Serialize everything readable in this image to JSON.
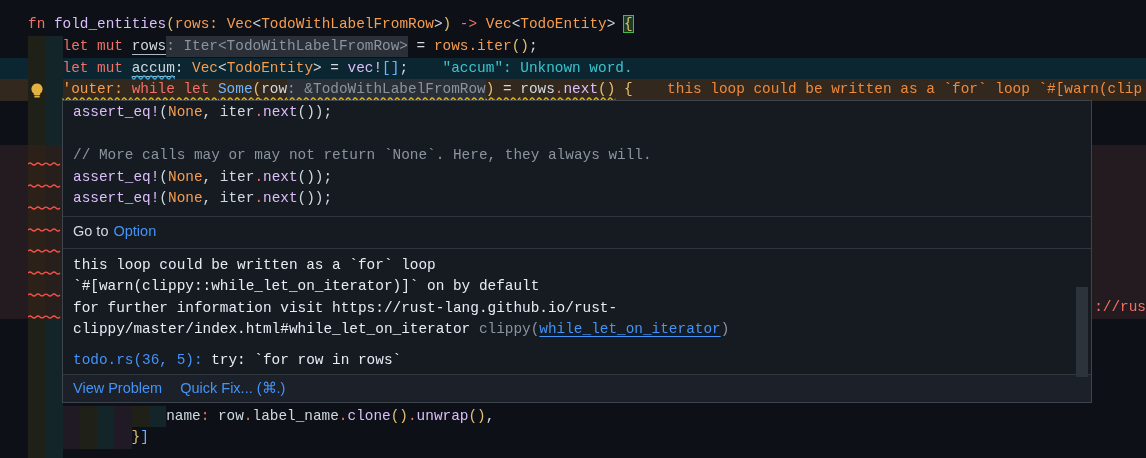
{
  "editor": {
    "lines": [
      {
        "kind": "code",
        "lightbulb": false,
        "tokens": [
          {
            "text": "fn ",
            "kind": "keyword"
          },
          {
            "text": "fold_entities",
            "kind": "function"
          },
          {
            "text": "(",
            "kind": "brace"
          },
          {
            "text": "rows: Vec",
            "kind": "type"
          },
          {
            "text": "<",
            "kind": "plain"
          },
          {
            "text": "TodoWithLabelFromRow",
            "kind": "type"
          },
          {
            "text": ">",
            "kind": "plain"
          },
          {
            "text": ")",
            "kind": "brace"
          },
          {
            "text": " -> ",
            "kind": "keyword"
          },
          {
            "text": "Vec",
            "kind": "type"
          },
          {
            "text": "<",
            "kind": "plain"
          },
          {
            "text": "TodoEntity",
            "kind": "type"
          },
          {
            "text": "> ",
            "kind": "plain"
          },
          {
            "text": "{",
            "kind": "brace",
            "matched": true
          }
        ]
      },
      {
        "kind": "code",
        "lightbulb": false,
        "tokens": [
          {
            "text": "    let mut ",
            "kind": "keyword"
          },
          {
            "text": "rows",
            "kind": "plain",
            "underline": true
          },
          {
            "text": ": Iter<TodoWithLabelFromRow>",
            "kind": "hint"
          },
          {
            "text": " = ",
            "kind": "plain"
          },
          {
            "text": "rows.iter",
            "kind": "type"
          },
          {
            "text": "()",
            "kind": "brace"
          },
          {
            "text": ";",
            "kind": "plain"
          }
        ]
      },
      {
        "kind": "info",
        "lightbulb": false,
        "tokens": [
          {
            "text": "    let mut ",
            "kind": "keyword"
          },
          {
            "text": "accum",
            "kind": "plain",
            "squiggle": true,
            "underline": true
          },
          {
            "text": ": ",
            "kind": "plain"
          },
          {
            "text": "Vec",
            "kind": "type"
          },
          {
            "text": "<",
            "kind": "plain"
          },
          {
            "text": "TodoEntity",
            "kind": "type"
          },
          {
            "text": "> = ",
            "kind": "plain"
          },
          {
            "text": "vec!",
            "kind": "function"
          },
          {
            "text": "[]",
            "kind": "enum"
          },
          {
            "text": ";",
            "kind": "plain"
          },
          {
            "text": "\"accum\": Unknown word.",
            "kind": "message"
          }
        ]
      },
      {
        "kind": "warning",
        "lightbulb": true,
        "tokens": [
          {
            "text": "    'outer: ",
            "kind": "type",
            "squiggle": true
          },
          {
            "text": "while let ",
            "kind": "keyword",
            "squiggle": true
          },
          {
            "text": "Some",
            "kind": "enum",
            "squiggle": true
          },
          {
            "text": "(",
            "kind": "brace",
            "squiggle": true
          },
          {
            "text": "row",
            "kind": "plain",
            "squiggle": true
          },
          {
            "text": ": &TodoWithLabelFromRow",
            "kind": "hint",
            "squiggle": true
          },
          {
            "text": ")",
            "kind": "brace",
            "squiggle": true
          },
          {
            "text": " = ",
            "kind": "plain",
            "squiggle": true
          },
          {
            "text": "rows",
            "kind": "plain",
            "squiggle": true
          },
          {
            "text": ".",
            "kind": "keyword",
            "squiggle": true
          },
          {
            "text": "next",
            "kind": "function",
            "squiggle": true
          },
          {
            "text": "()",
            "kind": "brace",
            "squiggle": true
          },
          {
            "text": " {",
            "kind": "brace"
          },
          {
            "text": "this loop could be written as a `for` loop `#[warn(clip",
            "kind": "message"
          }
        ]
      },
      {
        "kind": "covered"
      },
      {
        "kind": "covered"
      },
      {
        "kind": "error"
      },
      {
        "kind": "error"
      },
      {
        "kind": "error"
      },
      {
        "kind": "error"
      },
      {
        "kind": "error"
      },
      {
        "kind": "error"
      },
      {
        "kind": "error"
      },
      {
        "kind": "error",
        "tail": "://rus"
      },
      {
        "kind": "covered"
      },
      {
        "kind": "covered"
      },
      {
        "kind": "covered"
      },
      {
        "kind": "covered"
      },
      {
        "kind": "code",
        "lightbulb": false,
        "tokens": [
          {
            "text": "                name",
            "kind": "plain"
          },
          {
            "text": ":",
            "kind": "keyword"
          },
          {
            "text": " row",
            "kind": "plain"
          },
          {
            "text": ".",
            "kind": "keyword"
          },
          {
            "text": "label_name",
            "kind": "plain"
          },
          {
            "text": ".",
            "kind": "keyword"
          },
          {
            "text": "clone",
            "kind": "function"
          },
          {
            "text": "()",
            "kind": "brace"
          },
          {
            "text": ".",
            "kind": "keyword"
          },
          {
            "text": "unwrap",
            "kind": "function"
          },
          {
            "text": "()",
            "kind": "brace"
          },
          {
            "text": ",",
            "kind": "plain"
          }
        ]
      },
      {
        "kind": "code",
        "lightbulb": false,
        "tokens": [
          {
            "text": "            }",
            "kind": "brace"
          },
          {
            "text": "]",
            "kind": "enum"
          }
        ]
      },
      {
        "kind": "covered"
      }
    ]
  },
  "hover": {
    "doc_lines": [
      {
        "kind": "code",
        "tokens": [
          {
            "text": "assert_eq!",
            "kind": "function"
          },
          {
            "text": "(",
            "kind": "plain"
          },
          {
            "text": "None",
            "kind": "type"
          },
          {
            "text": ", iter",
            "kind": "plain"
          },
          {
            "text": ".",
            "kind": "keyword"
          },
          {
            "text": "next",
            "kind": "function"
          },
          {
            "text": "());",
            "kind": "plain"
          }
        ]
      },
      {
        "kind": "blank"
      },
      {
        "kind": "code",
        "tokens": [
          {
            "text": "// More calls may or may not return `None`. Here, they always will.",
            "kind": "comment"
          }
        ]
      },
      {
        "kind": "code",
        "tokens": [
          {
            "text": "assert_eq!",
            "kind": "function"
          },
          {
            "text": "(",
            "kind": "plain"
          },
          {
            "text": "None",
            "kind": "type"
          },
          {
            "text": ", iter",
            "kind": "plain"
          },
          {
            "text": ".",
            "kind": "keyword"
          },
          {
            "text": "next",
            "kind": "function"
          },
          {
            "text": "());",
            "kind": "plain"
          }
        ]
      },
      {
        "kind": "code",
        "tokens": [
          {
            "text": "assert_eq!",
            "kind": "function"
          },
          {
            "text": "(",
            "kind": "plain"
          },
          {
            "text": "None",
            "kind": "type"
          },
          {
            "text": ", iter",
            "kind": "plain"
          },
          {
            "text": ".",
            "kind": "keyword"
          },
          {
            "text": "next",
            "kind": "function"
          },
          {
            "text": "());",
            "kind": "plain"
          }
        ]
      }
    ],
    "go_to": {
      "label": "Go to",
      "link": "Option"
    },
    "message_lines": [
      "this loop could be written as a `for` loop",
      "`#[warn(clippy::while_let_on_iterator)]` on by default",
      "for further information visit https://rust-lang.github.io/rust-",
      "clippy/master/index.html#while_let_on_iterator"
    ],
    "source_prefix": "clippy(",
    "code_link": "while_let_on_iterator",
    "source_suffix": ")",
    "related": {
      "location": "todo.rs(36, 5):",
      "text": "try: `for row in rows`"
    },
    "actions": [
      "View Problem",
      "Quick Fix... (⌘.)"
    ]
  }
}
